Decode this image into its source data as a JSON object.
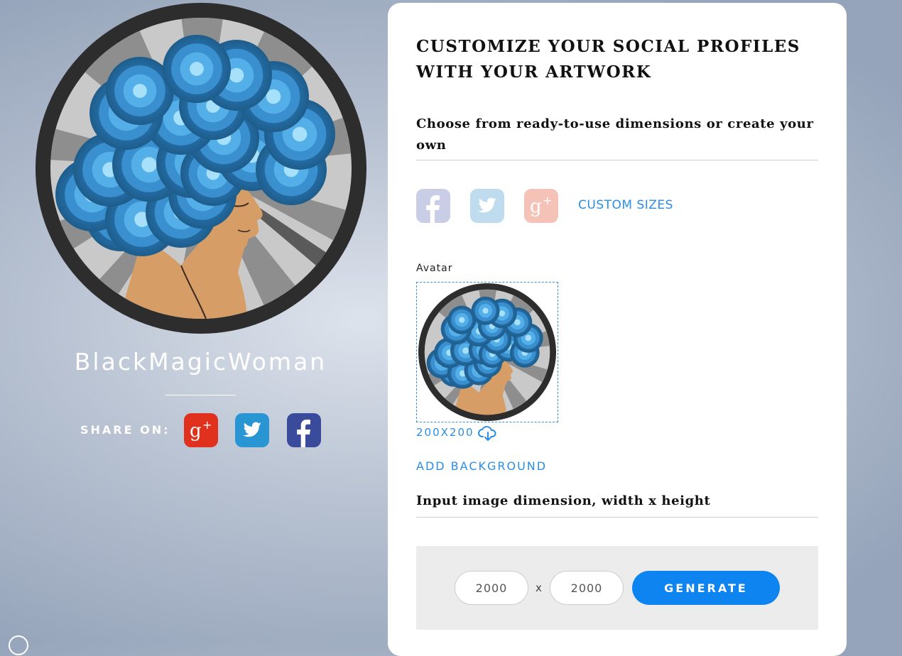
{
  "artist": {
    "name": "BlackMagicWoman",
    "share_label": "SHARE ON:",
    "share_buttons": [
      {
        "network": "Google+",
        "icon": "google-plus-icon",
        "color": "#e0301e",
        "glyph": "g+"
      },
      {
        "network": "Twitter",
        "icon": "twitter-icon",
        "color": "#2996d3",
        "glyph": "bird"
      },
      {
        "network": "Facebook",
        "icon": "facebook-icon",
        "color": "#3b4b9c",
        "glyph": "f"
      }
    ]
  },
  "panel": {
    "title": "CUSTOMIZE YOUR SOCIAL PROFILES WITH YOUR ARTWORK",
    "subtitle": "Choose from ready-to-use dimensions or create your own",
    "networks": [
      {
        "name": "Facebook",
        "icon": "facebook-icon",
        "color": "#c9cde6"
      },
      {
        "name": "Twitter",
        "icon": "twitter-icon",
        "color": "#bfdcef"
      },
      {
        "name": "Google+",
        "icon": "google-plus-icon",
        "color": "#f5c2b8"
      }
    ],
    "custom_sizes_label": "CUSTOM SIZES",
    "avatar": {
      "label": "Avatar",
      "dimensions": "200X200",
      "download_icon": "cloud-download-icon"
    },
    "add_background_label": "ADD BACKGROUND",
    "dimension_label": "Input image dimension, width x height",
    "width_value": "2000",
    "height_value": "2000",
    "times_symbol": "x",
    "generate_label": "GENERATE"
  },
  "colors": {
    "accent": "#2b8de4",
    "generate_button": "#0d84ef",
    "hair_dark": "#1f5f8e",
    "hair_light": "#8dd3f5",
    "skin": "#d69e66",
    "frame": "#2d2d2d"
  }
}
